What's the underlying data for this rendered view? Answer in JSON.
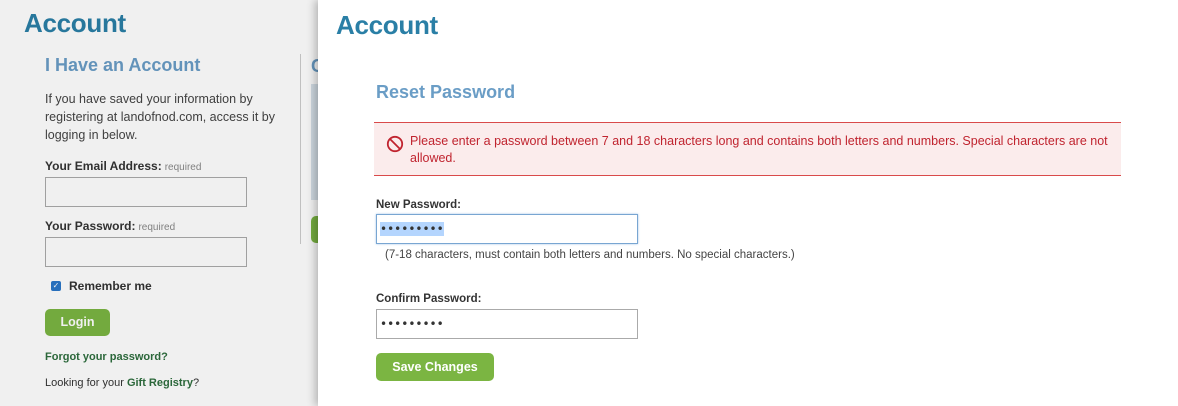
{
  "background_page": {
    "title": "Account",
    "login": {
      "heading": "I Have an Account",
      "intro": "If you have saved your information by registering at landofnod.com, access it by logging in below.",
      "email_label": "Your Email Address:",
      "email_required": "required",
      "password_label": "Your Password:",
      "password_required": "required",
      "remember_label": "Remember me",
      "remember_checked": true,
      "login_button": "Login",
      "forgot_link": "Forgot your password?",
      "registry_prefix": "Looking for your ",
      "registry_link": "Gift Registry",
      "registry_suffix": "?"
    },
    "peek_heading": "C"
  },
  "modal": {
    "title": "Account",
    "heading": "Reset Password",
    "error": {
      "icon": "prohibited-icon",
      "message": "Please enter a password between 7 and 18 characters long and contains both letters and numbers. Special characters are not allowed.",
      "color": "#c0242f"
    },
    "new_password": {
      "label": "New Password:",
      "value": "•••••••••",
      "hint": "(7-18 characters, must contain both letters and numbers. No special characters.)"
    },
    "confirm_password": {
      "label": "Confirm Password:",
      "value": "•••••••••"
    },
    "save_button": "Save Changes"
  },
  "colors": {
    "title_blue": "#2a7fa6",
    "heading_blue": "#6a9dc6",
    "button_green": "#7bb542",
    "link_green": "#2e6e3e",
    "error_red": "#d94a4a"
  }
}
